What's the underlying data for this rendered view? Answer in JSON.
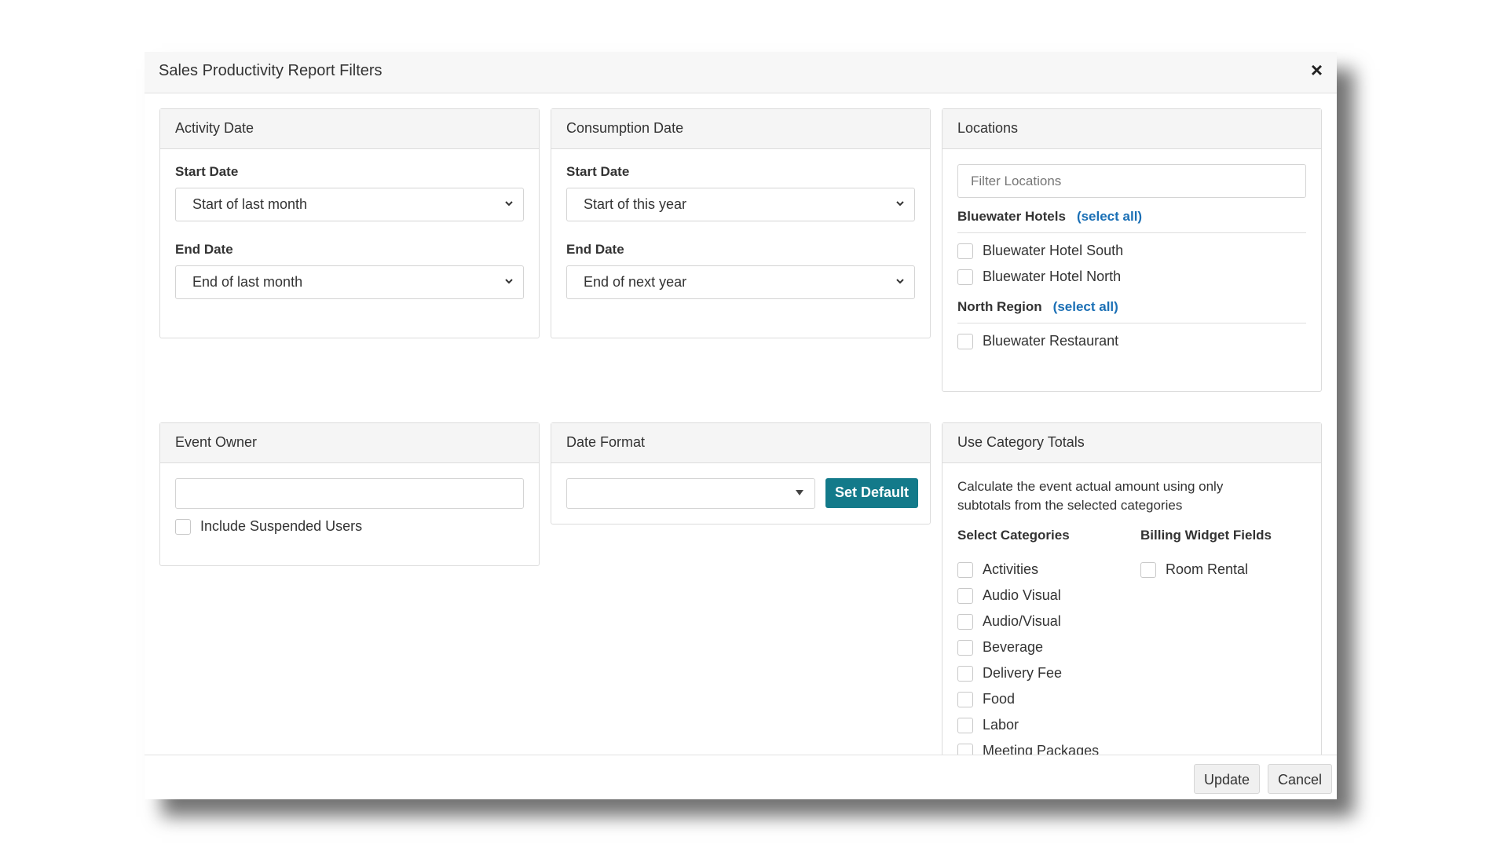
{
  "dialog": {
    "title": "Sales Productivity Report Filters",
    "close_icon": "close-icon"
  },
  "activity_date": {
    "heading": "Activity Date",
    "start_label": "Start Date",
    "start_value": "Start of last month",
    "end_label": "End Date",
    "end_value": "End of last month"
  },
  "consumption_date": {
    "heading": "Consumption Date",
    "start_label": "Start Date",
    "start_value": "Start of this year",
    "end_label": "End Date",
    "end_value": "End of next year"
  },
  "locations": {
    "heading": "Locations",
    "filter_placeholder": "Filter Locations",
    "groups": [
      {
        "name": "Bluewater Hotels",
        "select_all": "(select all)",
        "items": [
          "Bluewater Hotel South",
          "Bluewater Hotel North"
        ]
      },
      {
        "name": "North Region",
        "select_all": "(select all)",
        "items": [
          "Bluewater Restaurant"
        ]
      }
    ]
  },
  "event_owner": {
    "heading": "Event Owner",
    "input_value": "",
    "include_suspended_label": "Include Suspended Users"
  },
  "date_format": {
    "heading": "Date Format",
    "selected": "",
    "set_default_label": "Set Default"
  },
  "category_totals": {
    "heading": "Use Category Totals",
    "description": "Calculate the event actual amount using only subtotals from the selected categories",
    "select_categories_heading": "Select Categories",
    "categories": [
      "Activities",
      "Audio Visual",
      "Audio/Visual",
      "Beverage",
      "Delivery Fee",
      "Food",
      "Labor",
      "Meeting Packages"
    ],
    "billing_fields_heading": "Billing Widget Fields",
    "billing_fields": [
      "Room Rental"
    ]
  },
  "footer": {
    "update_label": "Update",
    "cancel_label": "Cancel"
  },
  "colors": {
    "accent_teal": "#137a8a",
    "link_blue": "#1a6fb5"
  }
}
